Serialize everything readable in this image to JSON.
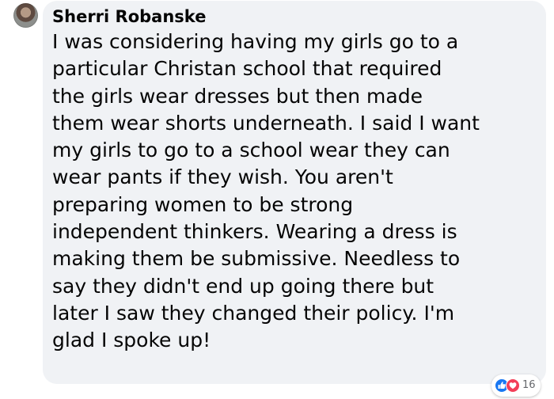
{
  "comment": {
    "author": "Sherri Robanske",
    "text": "I was considering having my girls go to a\nparticular Christan school that required\nthe girls wear dresses but then made\nthem wear shorts underneath. I said I want\nmy girls to go to a school wear they can\nwear pants if they wish. You aren't\npreparing women to be strong\nindependent thinkers. Wearing a dress is\nmaking them be submissive. Needless to\nsay they didn't end up going there but\nlater I saw they changed their policy. I'm\nglad I spoke up!",
    "avatar_icon": "user-avatar"
  },
  "reactions": {
    "icons": [
      "like-icon",
      "love-icon"
    ],
    "count": "16"
  },
  "colors": {
    "bubble": "#f0f2f5",
    "text": "#050505",
    "like": "#1877f2",
    "love": "#f33e58",
    "count": "#65676b"
  }
}
